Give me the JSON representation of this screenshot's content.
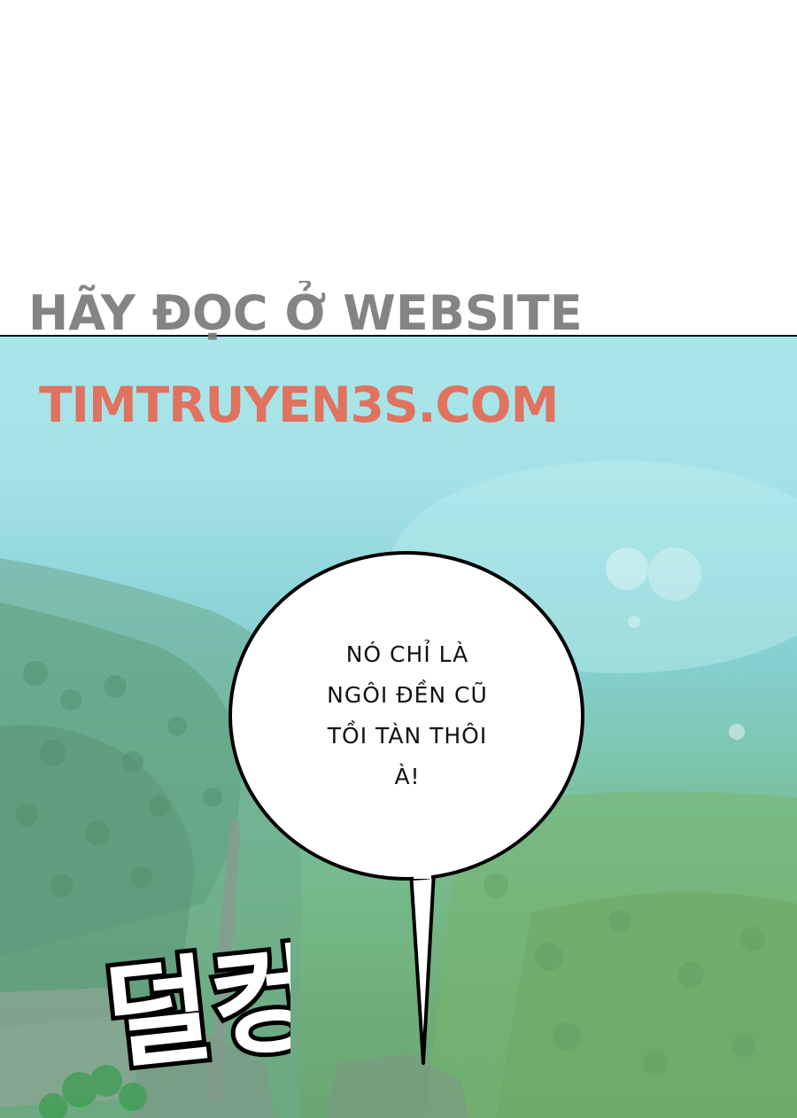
{
  "watermark": {
    "line1": "HÃY ĐỌC Ở WEBSITE",
    "line2": "TIMTRUYEN3S.COM",
    "colors": {
      "line1": "#7a7a7a",
      "line2": "#e0725f"
    }
  },
  "speech_bubble": {
    "lines": [
      "NÓ CHỈ LÀ",
      "NGÔI ĐỀN CŨ",
      "TỒI TÀN THÔI",
      "À!"
    ]
  },
  "sound_effect": {
    "text": "덜컹"
  },
  "colors": {
    "background_top": "#ffffff",
    "sky": "#a9e6ea",
    "foliage": "#6fae79"
  }
}
